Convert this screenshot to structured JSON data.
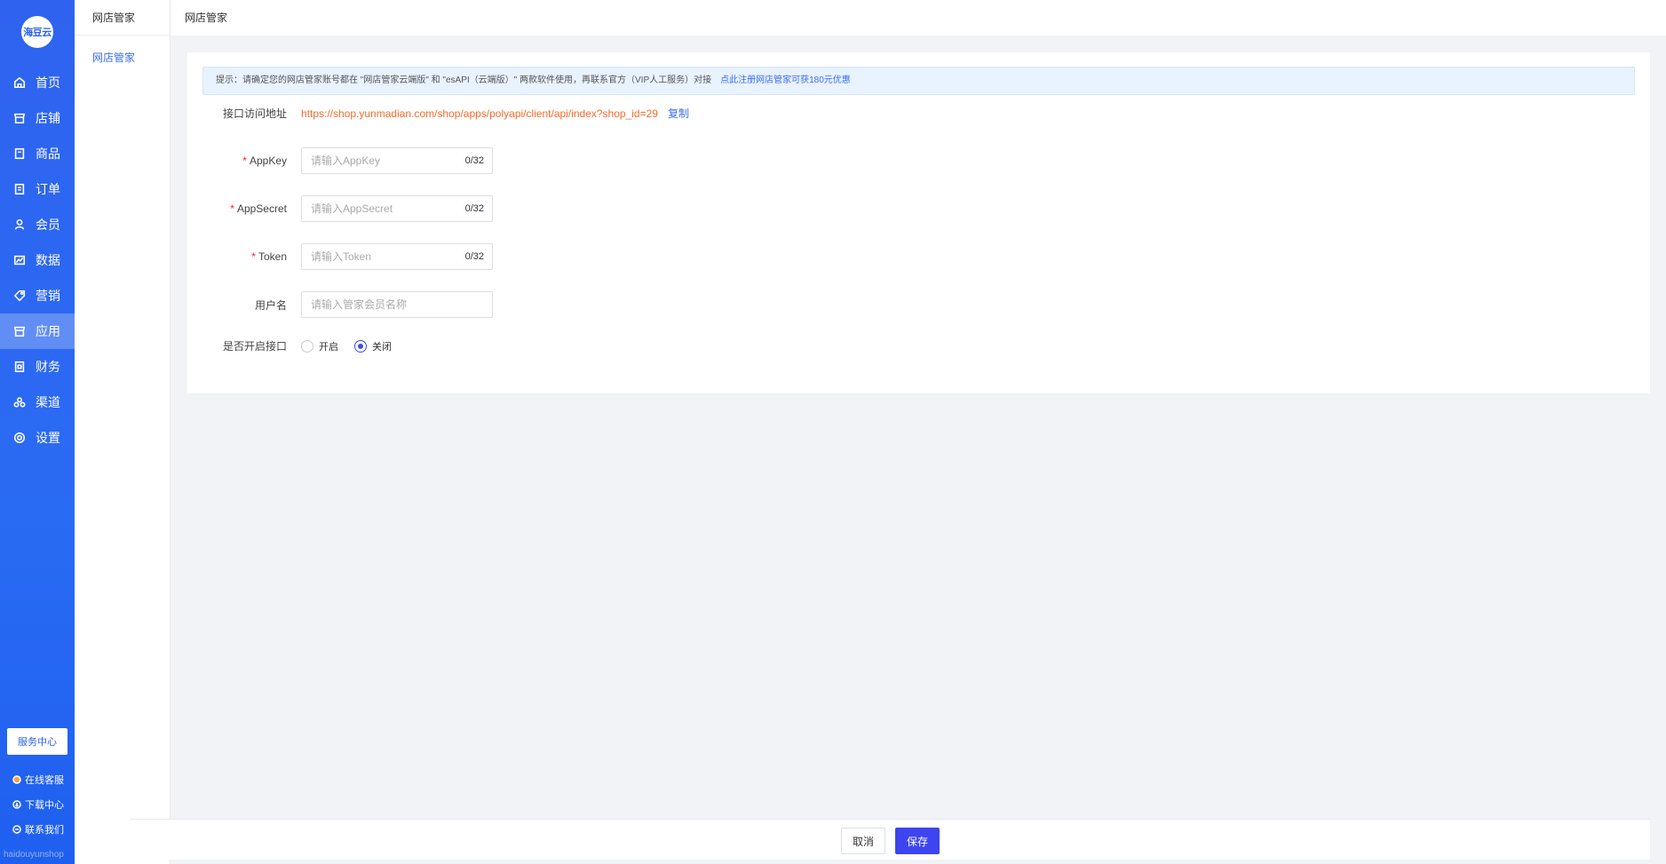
{
  "logo": {
    "text": "海豆云"
  },
  "nav": {
    "items": [
      {
        "label": "首页",
        "icon": "home-icon"
      },
      {
        "label": "店铺",
        "icon": "shop-icon"
      },
      {
        "label": "商品",
        "icon": "goods-icon"
      },
      {
        "label": "订单",
        "icon": "order-icon"
      },
      {
        "label": "会员",
        "icon": "user-icon"
      },
      {
        "label": "数据",
        "icon": "chart-icon"
      },
      {
        "label": "营销",
        "icon": "tag-icon"
      },
      {
        "label": "应用",
        "icon": "app-icon",
        "active": true
      },
      {
        "label": "财务",
        "icon": "finance-icon"
      },
      {
        "label": "渠道",
        "icon": "channel-icon"
      },
      {
        "label": "设置",
        "icon": "gear-icon"
      }
    ],
    "service_center": "服务中心",
    "bottom_links": [
      {
        "label": "在线客服",
        "icon": "chat-icon"
      },
      {
        "label": "下载中心",
        "icon": "download-icon"
      },
      {
        "label": "联系我们",
        "icon": "contact-icon"
      }
    ],
    "watermark": "haidouyunshop"
  },
  "subnav": {
    "header": "网店管家",
    "items": [
      {
        "label": "网店管家",
        "active": true
      }
    ]
  },
  "breadcrumb": "网店管家",
  "notice": {
    "text": "提示：请确定您的网店管家账号都在 \"网店管家云端版\" 和 \"esAPI（云端版）\" 两款软件使用，再联系官方（VIP人工服务）对接",
    "link": "点此注册网店管家可获180元优惠"
  },
  "form": {
    "api_url_label": "接口访问地址",
    "api_url": "https://shop.yunmadian.com/shop/apps/polyapi/client/api/index?shop_id=29",
    "copy_label": "复制",
    "appkey": {
      "label": "AppKey",
      "placeholder": "请输入AppKey",
      "counter": "0/32",
      "required": true
    },
    "appsecret": {
      "label": "AppSecret",
      "placeholder": "请输入AppSecret",
      "counter": "0/32",
      "required": true
    },
    "token": {
      "label": "Token",
      "placeholder": "请输入Token",
      "counter": "0/32",
      "required": true
    },
    "username": {
      "label": "用户名",
      "placeholder": "请输入管家会员名称"
    },
    "enable": {
      "label": "是否开启接口",
      "options": [
        "开启",
        "关闭"
      ],
      "selected": "关闭"
    }
  },
  "footer": {
    "cancel": "取消",
    "save": "保存"
  }
}
